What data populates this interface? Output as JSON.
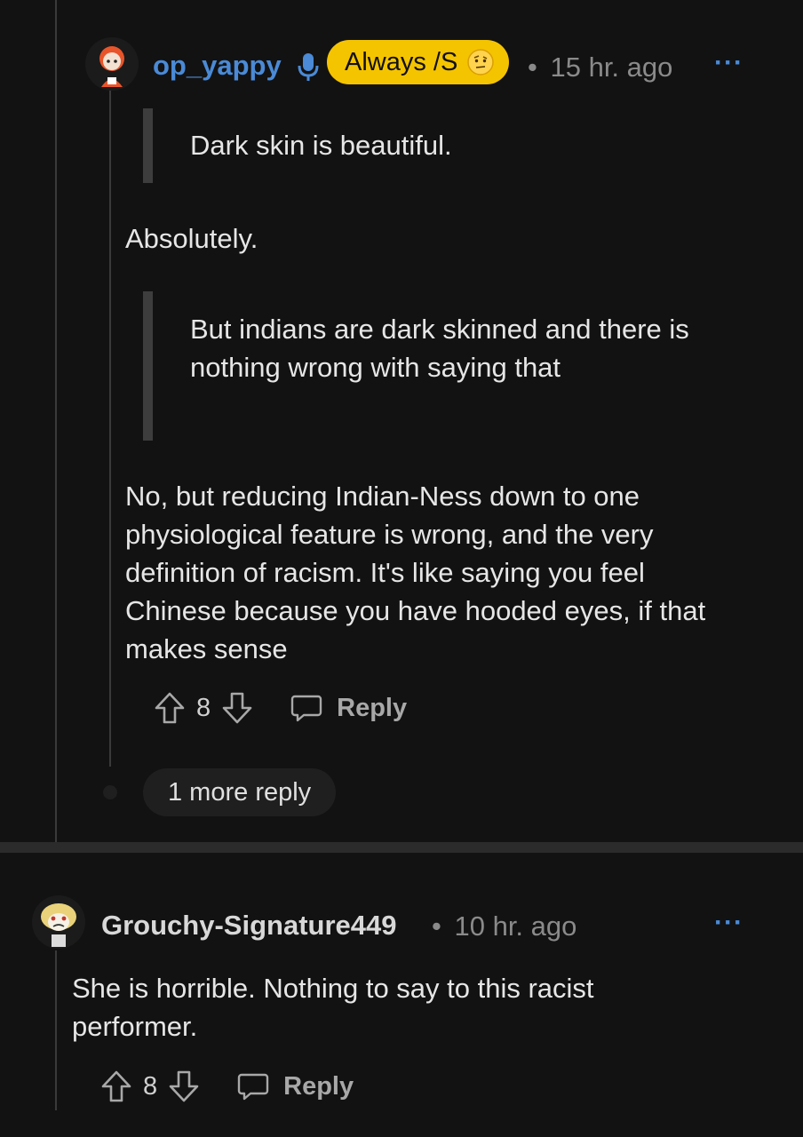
{
  "comment1": {
    "username": "op_yappy",
    "flair": "Always /S",
    "separator": "•",
    "time": "15 hr. ago",
    "more": "···",
    "quote1": "Dark skin is beautiful.",
    "reply1": "Absolutely.",
    "quote2": "But indians are dark skinned and there is nothing wrong with saying that",
    "reply2": "No, but reducing Indian-Ness down to one physiological feature is wrong, and the very definition of racism. It's like saying you feel Chinese because you have hooded eyes, if that makes sense",
    "votes": "8",
    "reply_label": "Reply",
    "more_replies": "1 more reply"
  },
  "comment2": {
    "username": "Grouchy-Signature449",
    "separator": "•",
    "time": "10 hr. ago",
    "more": "···",
    "body": "She is horrible. Nothing to say to this racist performer.",
    "votes": "8",
    "reply_label": "Reply"
  },
  "colors": {
    "background": "#121212",
    "username_blue": "#4a8ad6",
    "flair_yellow": "#f5c400",
    "meta_gray": "#8a8a8a"
  },
  "icons": [
    "mic-icon",
    "emoji-icon",
    "upvote-icon",
    "downvote-icon",
    "comment-icon",
    "snoo-avatar-icon"
  ]
}
